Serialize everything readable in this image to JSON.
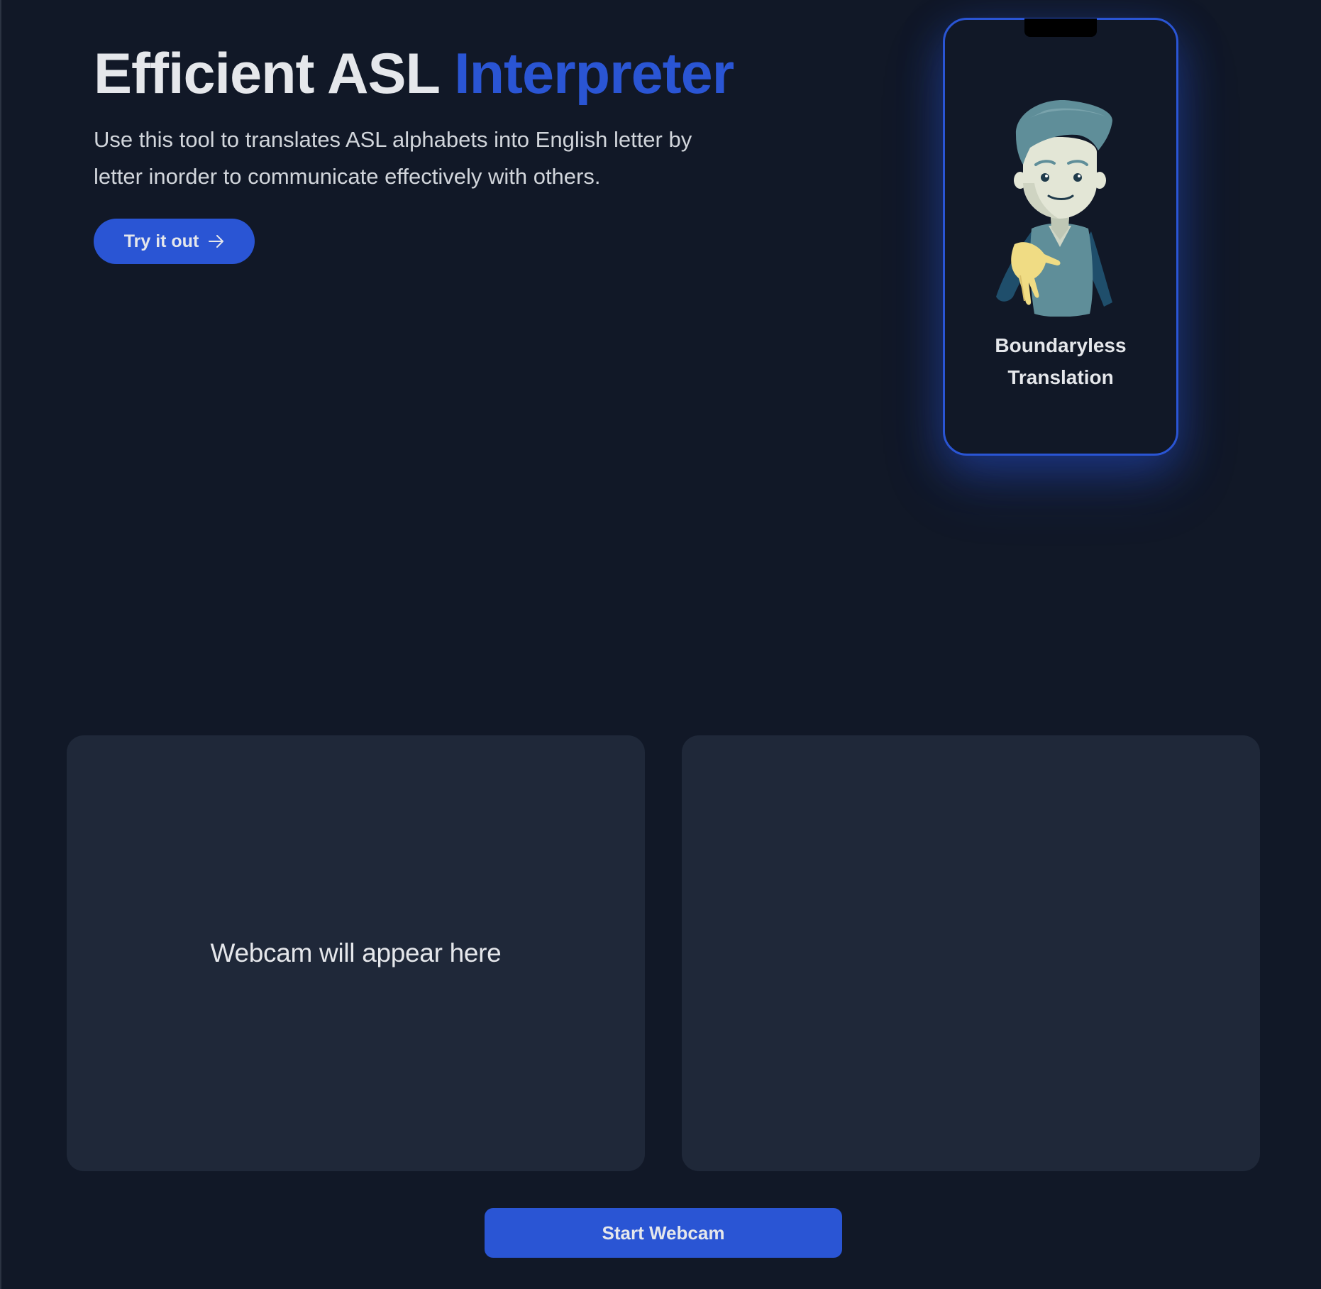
{
  "hero": {
    "title_main": "Efficient ASL ",
    "title_accent": "Interpreter",
    "description": "Use this tool to translates ASL alphabets into English letter by letter inorder to communicate effectively with others.",
    "cta_label": "Try it out",
    "cta_icon": "arrow-right-icon"
  },
  "phone_card": {
    "caption_line1": "Boundaryless",
    "caption_line2": "Translation",
    "illustration": "signing-person-illustration"
  },
  "webcam_panel": {
    "placeholder": "Webcam will appear here"
  },
  "output_panel": {},
  "actions": {
    "start_webcam_label": "Start Webcam"
  },
  "colors": {
    "background": "#111827",
    "panel": "#1f2839",
    "accent": "#2a55d4",
    "text": "#e5e7eb"
  }
}
